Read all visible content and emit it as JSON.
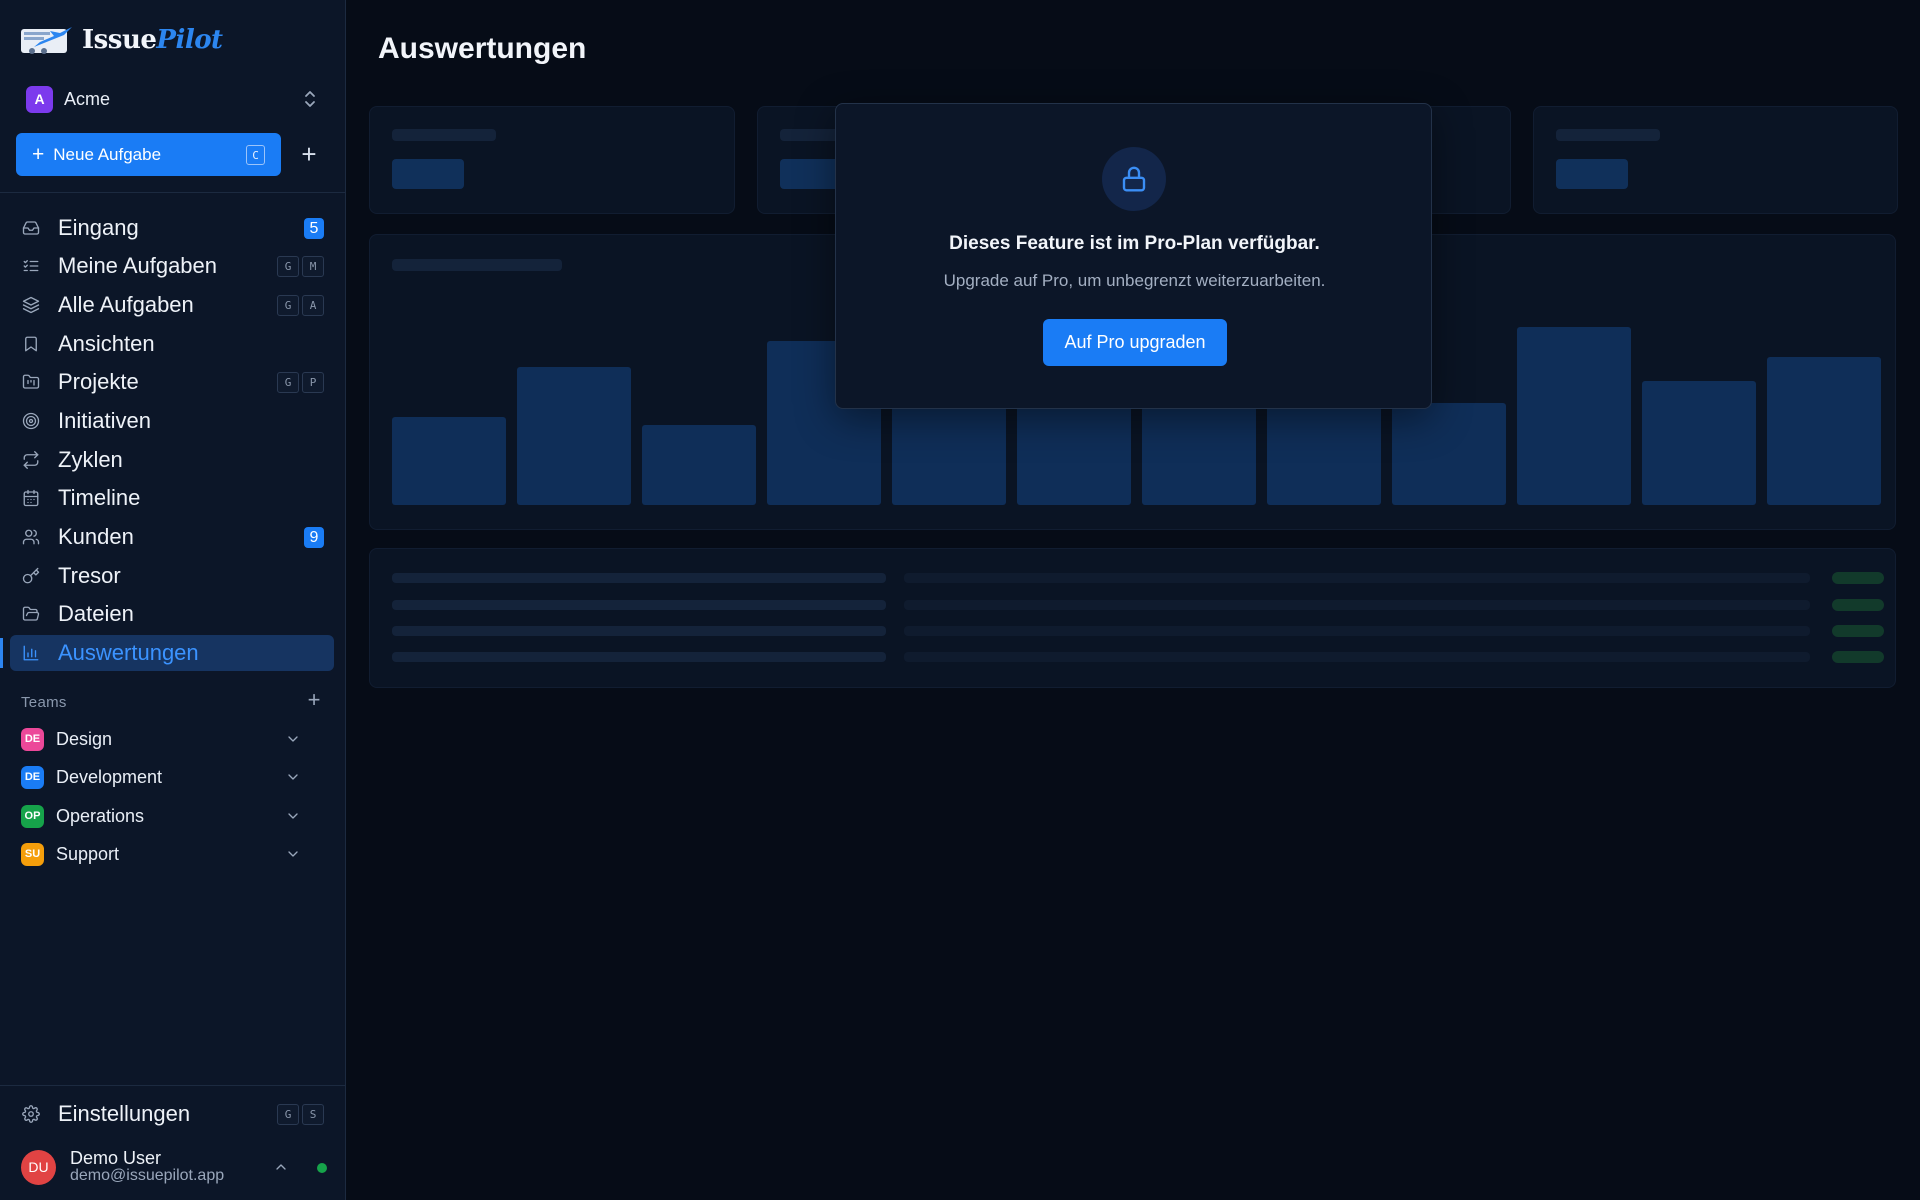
{
  "brand": {
    "name_part1": "Issue",
    "name_part2": "Pilot"
  },
  "workspace": {
    "avatar": "A",
    "name": "Acme"
  },
  "new_task": {
    "label": "Neue Aufgabe",
    "shortcut": "C"
  },
  "nav": {
    "items": [
      {
        "label": "Eingang",
        "icon": "inbox-icon",
        "badge": "5"
      },
      {
        "label": "Meine Aufgaben",
        "icon": "list-checks-icon",
        "shortcut": [
          "G",
          "M"
        ]
      },
      {
        "label": "Alle Aufgaben",
        "icon": "layers-icon",
        "shortcut": [
          "G",
          "A"
        ]
      },
      {
        "label": "Ansichten",
        "icon": "bookmark-icon"
      },
      {
        "label": "Projekte",
        "icon": "folder-kanban-icon",
        "shortcut": [
          "G",
          "P"
        ]
      },
      {
        "label": "Initiativen",
        "icon": "target-icon"
      },
      {
        "label": "Zyklen",
        "icon": "repeat-icon"
      },
      {
        "label": "Timeline",
        "icon": "calendar-icon"
      },
      {
        "label": "Kunden",
        "icon": "users-icon",
        "badge": "9"
      },
      {
        "label": "Tresor",
        "icon": "key-icon"
      },
      {
        "label": "Dateien",
        "icon": "folder-open-icon"
      },
      {
        "label": "Auswertungen",
        "icon": "bar-chart-icon",
        "active": true
      }
    ]
  },
  "teams": {
    "header": "Teams",
    "items": [
      {
        "abbr": "DE",
        "name": "Design",
        "color": "#ec4899"
      },
      {
        "abbr": "DE",
        "name": "Development",
        "color": "#1a7cf5"
      },
      {
        "abbr": "OP",
        "name": "Operations",
        "color": "#16a34a"
      },
      {
        "abbr": "SU",
        "name": "Support",
        "color": "#f59e0b"
      }
    ]
  },
  "settings": {
    "label": "Einstellungen",
    "shortcut": [
      "G",
      "S"
    ]
  },
  "user": {
    "initials": "DU",
    "name": "Demo User",
    "email": "demo@issuepilot.app"
  },
  "page": {
    "title": "Auswertungen"
  },
  "modal": {
    "title": "Dieses Feature ist im Pro-Plan verfügbar.",
    "subtitle": "Upgrade auf Pro, um unbegrenzt weiterzuarbeiten.",
    "button": "Auf Pro upgraden"
  },
  "colors": {
    "accent": "#1a7cf5",
    "sidebar_bg": "#0c1628",
    "main_bg": "#060c17"
  }
}
